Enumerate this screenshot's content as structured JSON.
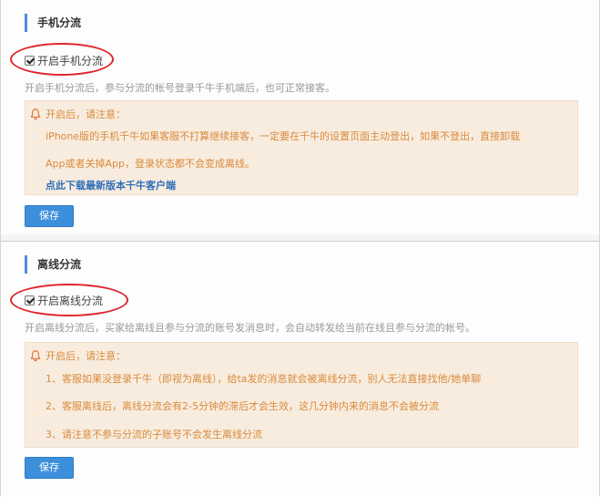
{
  "mobile": {
    "title": "手机分流",
    "checkbox_label": "开启手机分流",
    "description": "开启手机分流后，参与分流的帐号登录千牛手机端后，也可正常接客。",
    "notice_title": "开启后，请注意：",
    "notice_line1": "iPhone版的手机千牛如果客服不打算继续接客，一定要在千牛的设置页面主动登出，如果不登出，直接卸载",
    "notice_line2": "App或者关掉App，登录状态都不会变成离线。",
    "notice_link": "点此下载最新版本千牛客户端",
    "save_label": "保存"
  },
  "offline": {
    "title": "离线分流",
    "checkbox_label": "开启离线分流",
    "description": "开启离线分流后，买家给离线且参与分流的账号发消息时，会自动转发给当前在线且参与分流的帐号。",
    "notice_title": "开启后，请注意：",
    "notice_line1": "1、客服如果没登录千牛（即视为离线），给ta发的消息就会被离线分流，别人无法直接找他/她单聊",
    "notice_line2": "2、客服离线后，离线分流会有2-5分钟的滞后才会生效，这几分钟内来的消息不会被分流",
    "notice_line3": "3、请注意不参与分流的子账号不会发生离线分流",
    "save_label": "保存"
  },
  "colors": {
    "accent": "#3d8fdc",
    "notice_bg": "#f8ecdf",
    "notice_text": "#d98a3a",
    "highlight": "#e0242a"
  }
}
